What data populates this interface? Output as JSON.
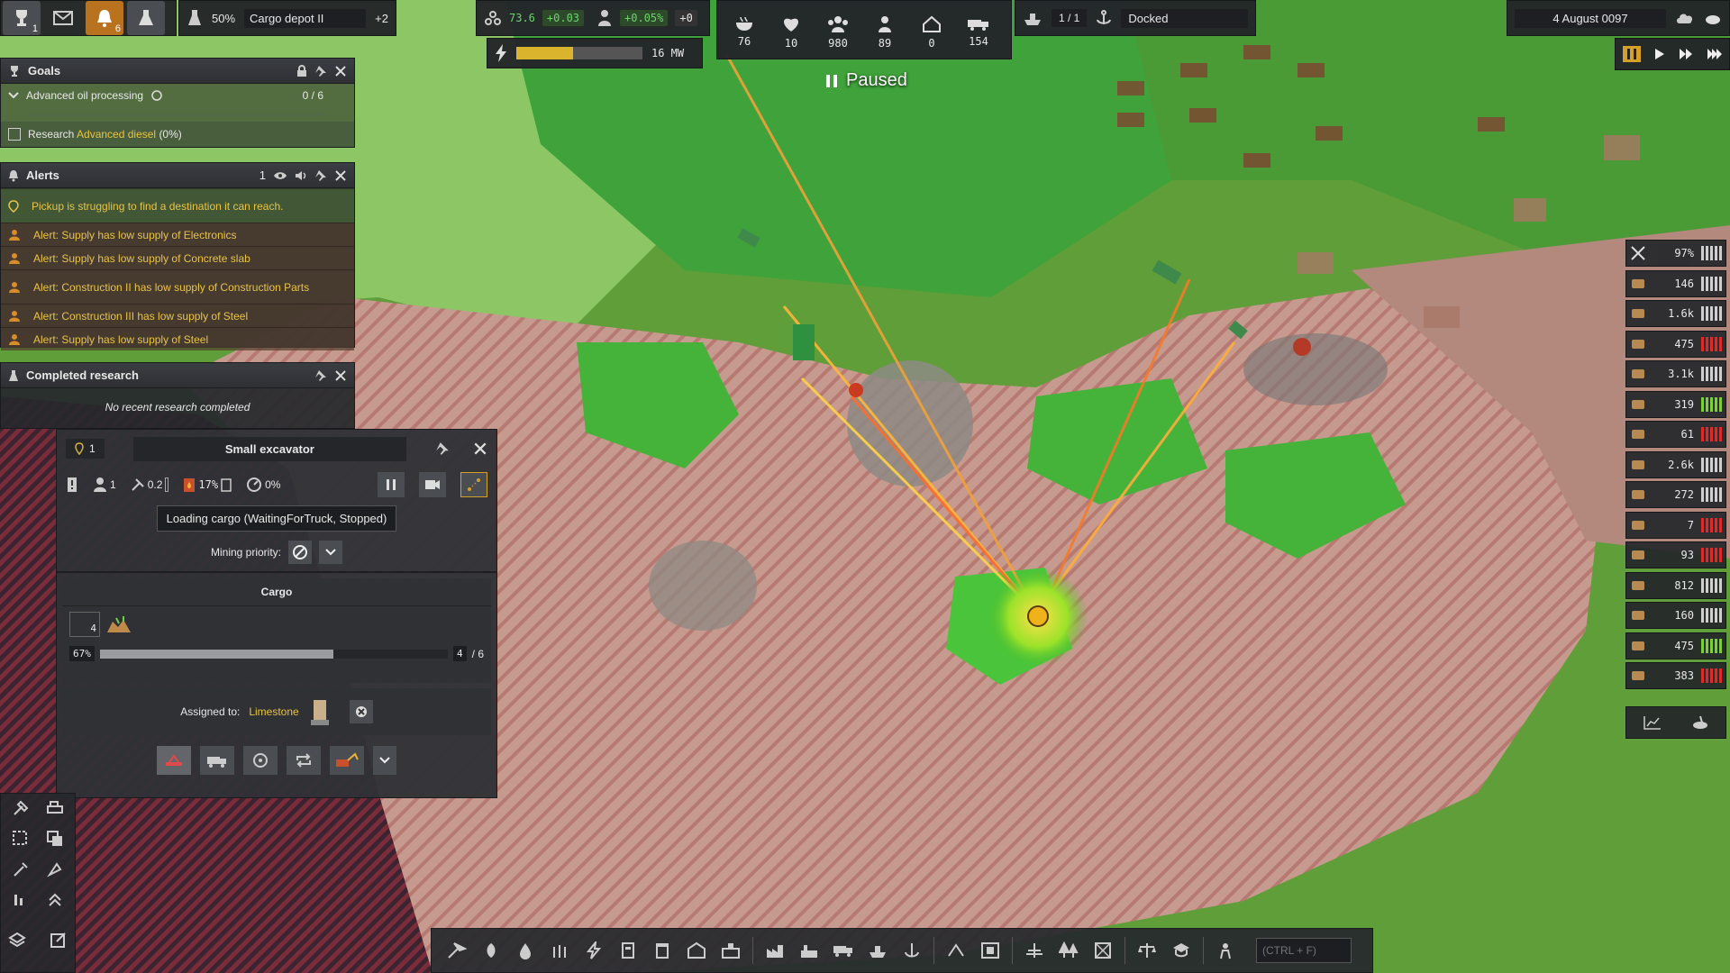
{
  "topbar": {
    "trophy_count": "1",
    "notifications_count": "6",
    "storage_percent": "50%",
    "cargo_depot_label": "Cargo depot II",
    "cargo_depot_extra": "+2",
    "unity_value": "73.6",
    "unity_delta": "+0.03",
    "pop_growth": "+0.05%",
    "pop_delta": "+0",
    "power_value": "16 MW",
    "power_fill": 0.45,
    "stats": [
      {
        "icon": "food-icon",
        "value": "76"
      },
      {
        "icon": "health-icon",
        "value": "10"
      },
      {
        "icon": "population-icon",
        "value": "980"
      },
      {
        "icon": "workers-icon",
        "value": "89"
      },
      {
        "icon": "housing-icon",
        "value": "0"
      },
      {
        "icon": "vehicles-icon",
        "value": "154"
      }
    ],
    "ship_count": "1 / 1",
    "ship_status": "Docked",
    "date": "4 August 0097"
  },
  "paused_label": "Paused",
  "goals": {
    "title": "Goals",
    "goal_name": "Advanced oil processing",
    "goal_progress": "0 / 6",
    "task_prefix": "Research",
    "task_highlight": "Advanced diesel",
    "task_suffix": "(0%)"
  },
  "alerts": {
    "title": "Alerts",
    "count": "1",
    "items": [
      {
        "icon": "warning-pin-icon",
        "text": "Pickup is struggling to find a destination it can reach."
      },
      {
        "icon": "supply-alert-icon",
        "text": "Alert: Supply has low supply of Electronics"
      },
      {
        "icon": "supply-alert-icon",
        "text": "Alert: Supply has low supply of Concrete slab"
      },
      {
        "icon": "supply-alert-icon",
        "text": "Alert: Construction II has low supply of Construction Parts"
      },
      {
        "icon": "supply-alert-icon",
        "text": "Alert: Construction III has low supply of Steel"
      },
      {
        "icon": "supply-alert-icon",
        "text": "Alert: Supply has low supply of Steel"
      }
    ]
  },
  "completed_research": {
    "title": "Completed research",
    "empty_text": "No recent research completed"
  },
  "excavator": {
    "title": "Small excavator",
    "pin_count": "1",
    "workers_value": "1",
    "maintenance_value": "0.2",
    "fuel_value": "17%",
    "efficiency_value": "0%",
    "status_text": "Loading cargo (WaitingForTruck, Stopped)",
    "mining_priority_label": "Mining priority:",
    "cargo_title": "Cargo",
    "cargo_qty": "4",
    "cargo_percent": "67%",
    "cargo_fill": 0.67,
    "cargo_current": "4",
    "cargo_max": "/ 6",
    "assigned_label": "Assigned to:",
    "assigned_target": "Limestone"
  },
  "resources": [
    {
      "icon": "maintenance-icon",
      "value": "97%",
      "color": "#cfcfcf"
    },
    {
      "icon": "barrel-icon",
      "value": "146",
      "color": "#cfcfcf"
    },
    {
      "icon": "coal-icon",
      "value": "1.6k",
      "color": "#cfcfcf"
    },
    {
      "icon": "iron-icon",
      "value": "475",
      "color": "#e02a2a"
    },
    {
      "icon": "wood-icon",
      "value": "3.1k",
      "color": "#cfcfcf"
    },
    {
      "icon": "worker-icon",
      "value": "319",
      "color": "#7ccf3a"
    },
    {
      "icon": "plank-icon",
      "value": "61",
      "color": "#e02a2a"
    },
    {
      "icon": "fuel-icon",
      "value": "2.6k",
      "color": "#cfcfcf"
    },
    {
      "icon": "steel-icon",
      "value": "272",
      "color": "#cfcfcf"
    },
    {
      "icon": "wrench-icon",
      "value": "7",
      "color": "#e02a2a"
    },
    {
      "icon": "slab-icon",
      "value": "93",
      "color": "#e02a2a"
    },
    {
      "icon": "electronics-icon",
      "value": "812",
      "color": "#cfcfcf"
    },
    {
      "icon": "glass-icon",
      "value": "160",
      "color": "#cfcfcf"
    },
    {
      "icon": "brick-icon",
      "value": "475",
      "color": "#7ccf3a"
    },
    {
      "icon": "parts-icon",
      "value": "383",
      "color": "#e02a2a"
    }
  ],
  "search_placeholder": "(CTRL + F)"
}
